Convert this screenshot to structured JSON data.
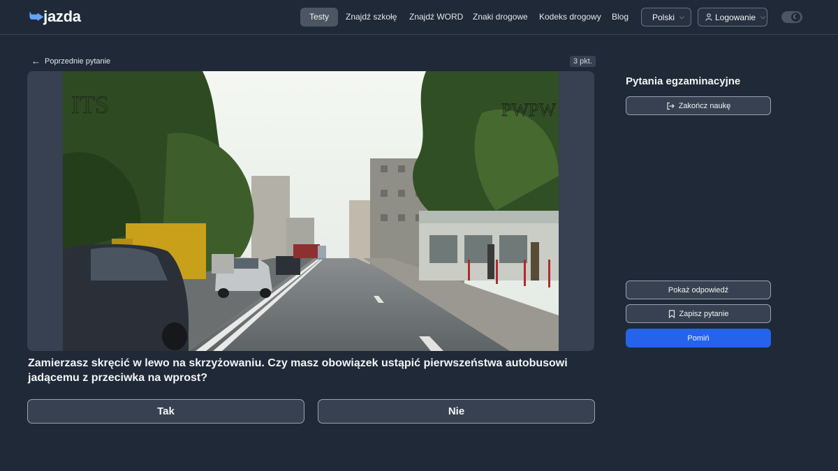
{
  "header": {
    "logo": "jazda",
    "nav": [
      "Testy",
      "Znajdź szkołę",
      "Znajdź WORD",
      "Znaki drogowe",
      "Kodeks drogowy",
      "Blog"
    ],
    "language": "Polski",
    "login": "Logowanie"
  },
  "question": {
    "back_label": "Poprzednie pytanie",
    "points": "3 pkt.",
    "watermark_left": "ITS",
    "watermark_right": "PWPW",
    "text": "Zamierzasz skręcić w lewo na skrzyżowaniu. Czy masz obowiązek ustąpić pierwszeństwa autobusowi jadącemu z przeciwka na wprost?",
    "answers": [
      "Tak",
      "Nie"
    ]
  },
  "sidebar": {
    "title": "Pytania egzaminacyjne",
    "finish": "Zakończ naukę",
    "show_answer": "Pokaż odpowiedź",
    "save": "Zapisz pytanie",
    "skip": "Pomiń"
  },
  "colors": {
    "accent": "#2563eb",
    "background": "#1f2937",
    "panel": "#374151"
  },
  "icons": [
    "arrow-left-icon",
    "user-icon",
    "chevron-down-icon",
    "moon-icon",
    "logout-icon",
    "bookmark-icon"
  ]
}
